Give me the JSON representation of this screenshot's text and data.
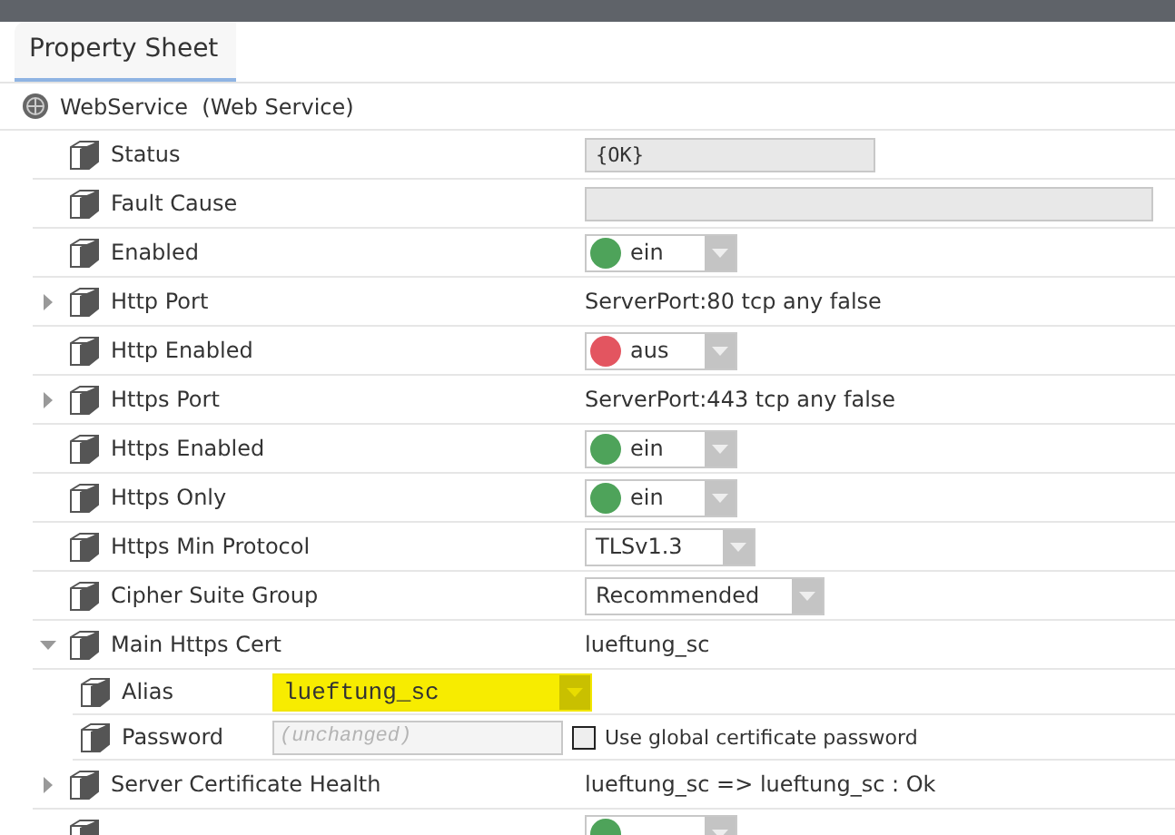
{
  "tab": {
    "label": "Property Sheet",
    "selected": true
  },
  "root": {
    "name": "WebService",
    "type": "(Web Service)"
  },
  "rows": [
    {
      "label": "Status",
      "kind": "readonly",
      "value": "{OK}",
      "wide": false
    },
    {
      "label": "Fault Cause",
      "kind": "readonly",
      "value": "",
      "wide": true
    },
    {
      "label": "Enabled",
      "kind": "toggle",
      "value": "ein",
      "on": true
    },
    {
      "label": "Http Port",
      "kind": "text",
      "value": "ServerPort:80 tcp any false",
      "expanded": false
    },
    {
      "label": "Http Enabled",
      "kind": "toggle",
      "value": "aus",
      "on": false
    },
    {
      "label": "Https Port",
      "kind": "text",
      "value": "ServerPort:443 tcp any false",
      "expanded": false
    },
    {
      "label": "Https Enabled",
      "kind": "toggle",
      "value": "ein",
      "on": true
    },
    {
      "label": "Https Only",
      "kind": "toggle",
      "value": "ein",
      "on": true
    },
    {
      "label": "Https Min Protocol",
      "kind": "select",
      "value": "TLSv1.3"
    },
    {
      "label": "Cipher Suite Group",
      "kind": "select",
      "value": "Recommended"
    },
    {
      "label": "Main Https Cert",
      "kind": "text",
      "value": "lueftung_sc",
      "expanded": true,
      "children": [
        {
          "label": "Alias",
          "kind": "combo",
          "value": "lueftung_sc",
          "highlighted": true
        },
        {
          "label": "Password",
          "kind": "password",
          "placeholder": "(unchanged)",
          "checkbox": {
            "label": "Use global certificate password",
            "checked": false
          }
        }
      ]
    },
    {
      "label": "Server Certificate Health",
      "kind": "text",
      "value": "lueftung_sc => lueftung_sc : Ok",
      "expanded": false
    },
    {
      "kind": "toggle",
      "on": true
    }
  ]
}
